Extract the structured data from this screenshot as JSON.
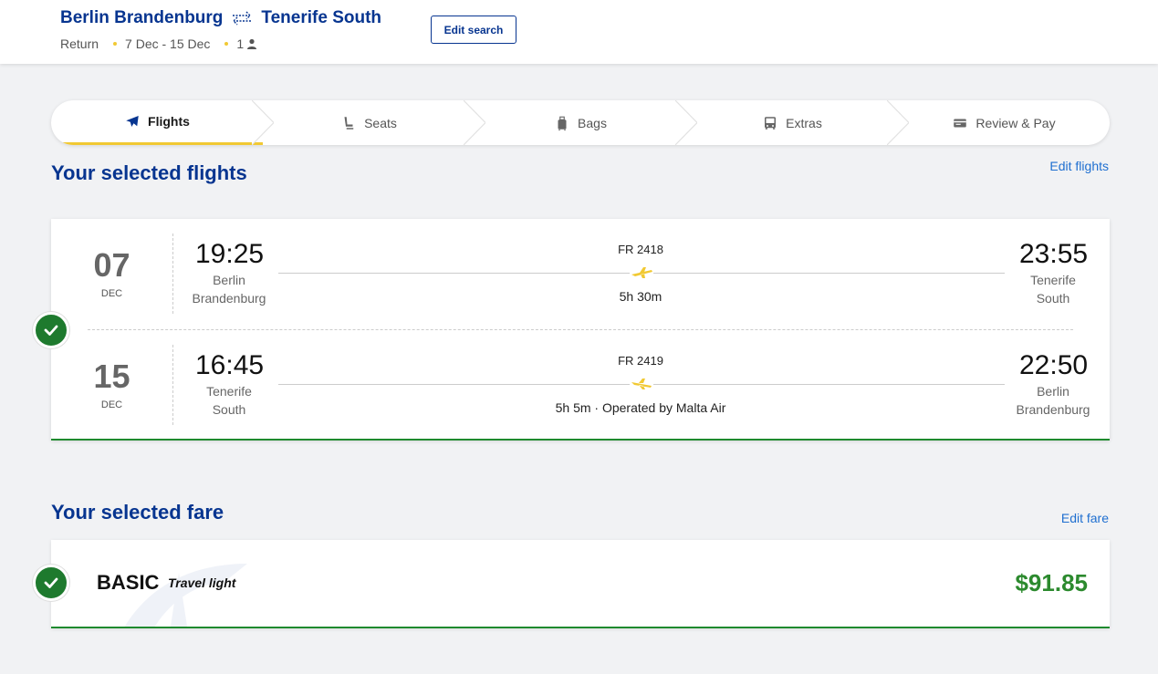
{
  "header": {
    "origin": "Berlin Brandenburg",
    "destination": "Tenerife South",
    "trip_type": "Return",
    "dates": "7 Dec - 15 Dec",
    "passengers": "1",
    "edit_search_label": "Edit search"
  },
  "steps": [
    {
      "label": "Flights",
      "icon": "plane-icon",
      "active": true
    },
    {
      "label": "Seats",
      "icon": "seat-icon",
      "active": false
    },
    {
      "label": "Bags",
      "icon": "bag-icon",
      "active": false
    },
    {
      "label": "Extras",
      "icon": "bus-icon",
      "active": false
    },
    {
      "label": "Review & Pay",
      "icon": "card-icon",
      "active": false
    }
  ],
  "flights_section": {
    "title": "Your selected flights",
    "edit_label": "Edit flights",
    "legs": [
      {
        "day": "07",
        "month": "DEC",
        "dep_time": "19:25",
        "dep_city_line1": "Berlin",
        "dep_city_line2": "Brandenburg",
        "flight_number": "FR 2418",
        "duration": "5h 30m",
        "arr_time": "23:55",
        "arr_city_line1": "Tenerife",
        "arr_city_line2": "South"
      },
      {
        "day": "15",
        "month": "DEC",
        "dep_time": "16:45",
        "dep_city_line1": "Tenerife",
        "dep_city_line2": "South",
        "flight_number": "FR 2419",
        "duration": "5h 5m · Operated by Malta Air",
        "arr_time": "22:50",
        "arr_city_line1": "Berlin",
        "arr_city_line2": "Brandenburg"
      }
    ]
  },
  "fare_section": {
    "title": "Your selected fare",
    "edit_label": "Edit fare",
    "fare_name": "BASIC",
    "fare_tagline": "Travel light",
    "price": "$91.85"
  },
  "colors": {
    "brand_blue": "#073590",
    "accent_yellow": "#f1c933",
    "success_green": "#1e7a2e",
    "link_blue": "#1f6fd0"
  }
}
